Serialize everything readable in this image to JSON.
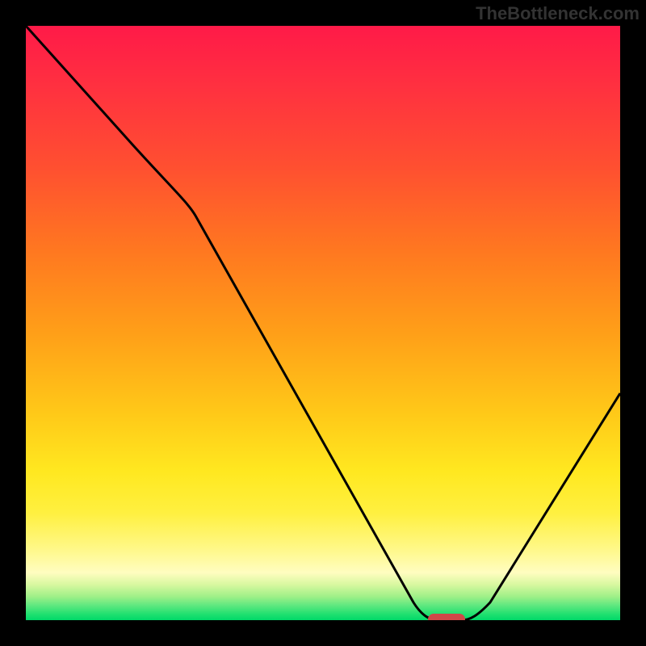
{
  "watermark": "TheBottleneck.com",
  "chart_data": {
    "type": "line",
    "title": "",
    "xlabel": "",
    "ylabel": "",
    "xlim": [
      0,
      100
    ],
    "ylim": [
      0,
      100
    ],
    "series": [
      {
        "name": "curve",
        "x": [
          0,
          18,
          28,
          65,
          68,
          74,
          78,
          100
        ],
        "y": [
          100,
          80,
          71,
          3,
          0,
          0,
          3,
          38
        ]
      }
    ],
    "marker": {
      "x_start": 68,
      "x_end": 74,
      "y": 0
    },
    "background_gradient": {
      "stops": [
        {
          "pos": 0,
          "color": "#ff1a48"
        },
        {
          "pos": 50,
          "color": "#ffb018"
        },
        {
          "pos": 85,
          "color": "#fff060"
        },
        {
          "pos": 100,
          "color": "#00d868"
        }
      ]
    }
  }
}
